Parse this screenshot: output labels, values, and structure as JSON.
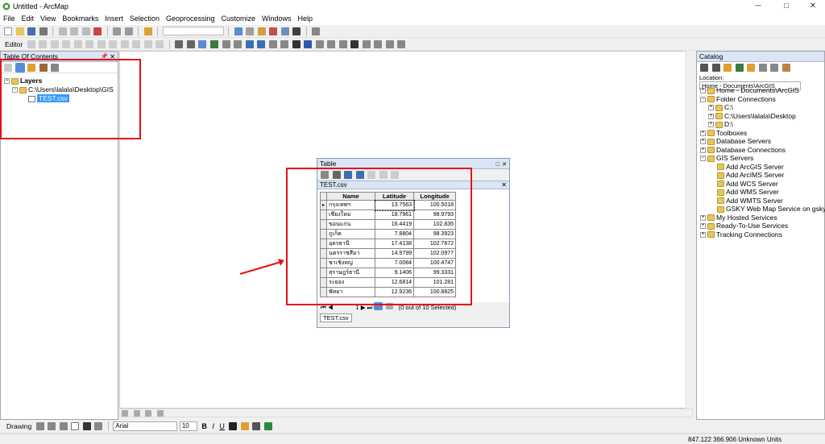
{
  "window": {
    "title": "Untitled - ArcMap",
    "minimize": "─",
    "maximize": "□",
    "close": "✕"
  },
  "menu": [
    "File",
    "Edit",
    "View",
    "Bookmarks",
    "Insert",
    "Selection",
    "Geoprocessing",
    "Customize",
    "Windows",
    "Help"
  ],
  "editor_toolbar": {
    "label": "Editor"
  },
  "toc": {
    "title": "Table Of Contents",
    "pin": "📌",
    "close": "✕",
    "layers_label": "Layers",
    "folder": "C:\\Users\\lalala\\Desktop\\GIS",
    "table": "TEST.csv"
  },
  "catalog": {
    "title": "Catalog",
    "location_label": "Location:",
    "location_value": "Home - Documents\\ArcGIS",
    "items": [
      {
        "label": "Home - Documents\\ArcGIS",
        "indent": 0,
        "expander": "+"
      },
      {
        "label": "Folder Connections",
        "indent": 0,
        "expander": "−"
      },
      {
        "label": "C:\\",
        "indent": 1,
        "expander": "+"
      },
      {
        "label": "C:\\Users\\lalala\\Desktop",
        "indent": 1,
        "expander": "+"
      },
      {
        "label": "D:\\",
        "indent": 1,
        "expander": "+"
      },
      {
        "label": "Toolboxes",
        "indent": 0,
        "expander": "+"
      },
      {
        "label": "Database Servers",
        "indent": 0,
        "expander": "+"
      },
      {
        "label": "Database Connections",
        "indent": 0,
        "expander": "+"
      },
      {
        "label": "GIS Servers",
        "indent": 0,
        "expander": "−"
      },
      {
        "label": "Add ArcGIS Server",
        "indent": 1,
        "expander": ""
      },
      {
        "label": "Add ArcIMS Server",
        "indent": 1,
        "expander": ""
      },
      {
        "label": "Add WCS Server",
        "indent": 1,
        "expander": ""
      },
      {
        "label": "Add WMS Server",
        "indent": 1,
        "expander": ""
      },
      {
        "label": "Add WMTS Server",
        "indent": 1,
        "expander": ""
      },
      {
        "label": "GSKY Web Map Service on gsky.nci",
        "indent": 1,
        "expander": ""
      },
      {
        "label": "My Hosted Services",
        "indent": 0,
        "expander": "+"
      },
      {
        "label": "Ready-To-Use Services",
        "indent": 0,
        "expander": "+"
      },
      {
        "label": "Tracking Connections",
        "indent": 0,
        "expander": "+"
      }
    ]
  },
  "table_window": {
    "title": "Table",
    "tab_title": "TEST.csv",
    "columns": [
      "Name",
      "Latitude",
      "Longitude"
    ],
    "rows": [
      [
        "กรุงเทพฯ",
        "13.7563",
        "100.5018"
      ],
      [
        "เชียงใหม่",
        "18.7961",
        "98.9793"
      ],
      [
        "ขอนแก่น",
        "16.4419",
        "102.835"
      ],
      [
        "ภูเก็ต",
        "7.8804",
        "98.3923"
      ],
      [
        "อุดรธานี",
        "17.4138",
        "102.7872"
      ],
      [
        "นครราชสีมา",
        "14.9799",
        "102.0977"
      ],
      [
        "ชาเชิงหญ่",
        "7.0084",
        "100.4747"
      ],
      [
        "สุราษฎร์ธานี",
        "9.1406",
        "99.3331"
      ],
      [
        "ระยอง",
        "12.6814",
        "101.281"
      ],
      [
        "พัทยา",
        "12.9236",
        "100.8825"
      ]
    ],
    "record": "1",
    "selected": "(0 out of 10 Selected)",
    "bottom_tab": "TEST.csv"
  },
  "drawing_toolbar": {
    "label": "Drawing",
    "font": "Arial",
    "size": "10",
    "bold": "B",
    "italic": "I",
    "underline": "U"
  },
  "status": {
    "coords": "847.122  366.906 Unknown Units"
  },
  "colors": {
    "accent": "#dbe5f3",
    "highlight": "#3399ff",
    "annotation": "#e8101a"
  }
}
